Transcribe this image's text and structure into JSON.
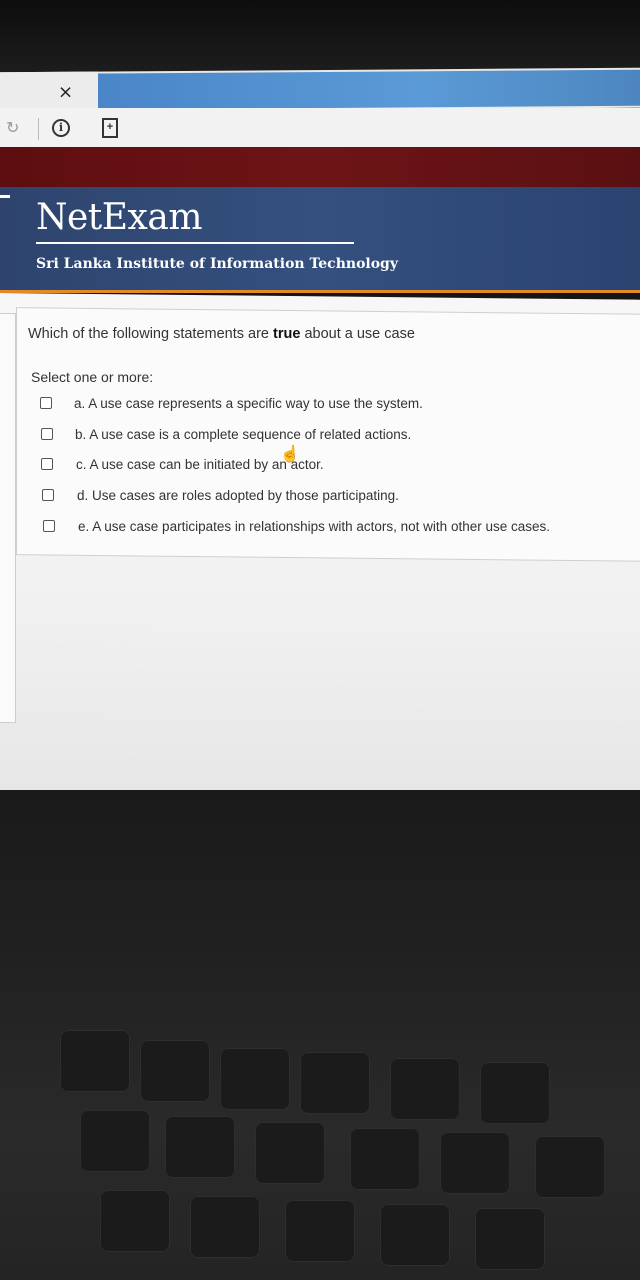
{
  "browser": {
    "close_glyph": "×",
    "icons": [
      "reload-icon",
      "info-icon",
      "page-icon"
    ]
  },
  "header": {
    "logo": "NetExam",
    "institute": "Sri Lanka Institute of Information Technology"
  },
  "question": {
    "prefix": "Which of the following statements are ",
    "emphasis": "true",
    "suffix": " about a use case",
    "instruction": "Select one or more:",
    "options": [
      {
        "label": "a. A use case represents a specific way to use the system.",
        "checked": false
      },
      {
        "label": "b. A use case is a complete sequence of related actions.",
        "checked": false
      },
      {
        "label": "c. A use case can be initiated by an actor.",
        "checked": false
      },
      {
        "label": "d. Use cases are roles adopted by those participating.",
        "checked": false
      },
      {
        "label": "e. A use case participates in relationships with actors, not with other use cases.",
        "checked": false
      }
    ]
  },
  "colors": {
    "maroon": "#6d1416",
    "header_blue": "#34507e",
    "accent_orange": "#e28a2a",
    "tab_blue": "#5a9ad6"
  }
}
